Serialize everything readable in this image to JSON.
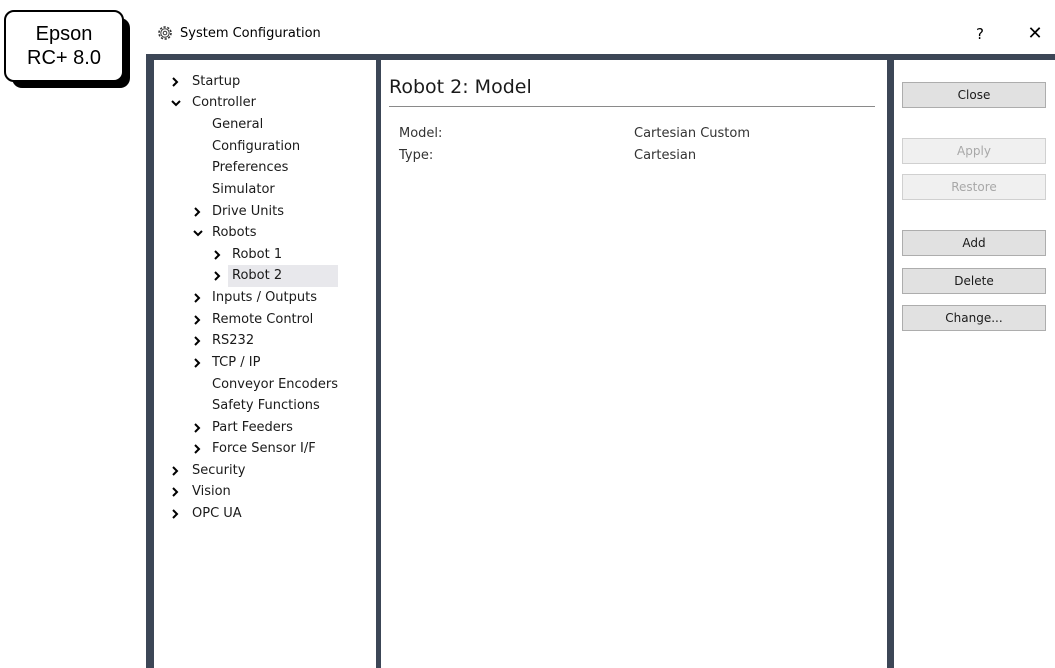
{
  "label_box": {
    "line1": "Epson",
    "line2": "RC+ 8.0"
  },
  "window": {
    "title": "System Configuration",
    "icon": "gear-icon",
    "help_label": "?",
    "close_label": "✕"
  },
  "tree": {
    "startup": "Startup",
    "controller": "Controller",
    "general": "General",
    "configuration": "Configuration",
    "preferences": "Preferences",
    "simulator": "Simulator",
    "drive_units": "Drive Units",
    "robots": "Robots",
    "robot1": "Robot 1",
    "robot2": "Robot 2",
    "inputs_outputs": "Inputs / Outputs",
    "remote_control": "Remote Control",
    "rs232": "RS232",
    "tcpip": "TCP / IP",
    "conveyor_encoders": "Conveyor Encoders",
    "safety_functions": "Safety Functions",
    "part_feeders": "Part Feeders",
    "force_sensor": "Force Sensor I/F",
    "security": "Security",
    "vision": "Vision",
    "opcua": "OPC UA"
  },
  "content": {
    "title": "Robot 2: Model",
    "model_label": "Model:",
    "model_value": "Cartesian Custom",
    "type_label": "Type:",
    "type_value": "Cartesian"
  },
  "buttons": {
    "close": "Close",
    "apply": "Apply",
    "restore": "Restore",
    "add": "Add",
    "delete": "Delete",
    "change": "Change..."
  }
}
